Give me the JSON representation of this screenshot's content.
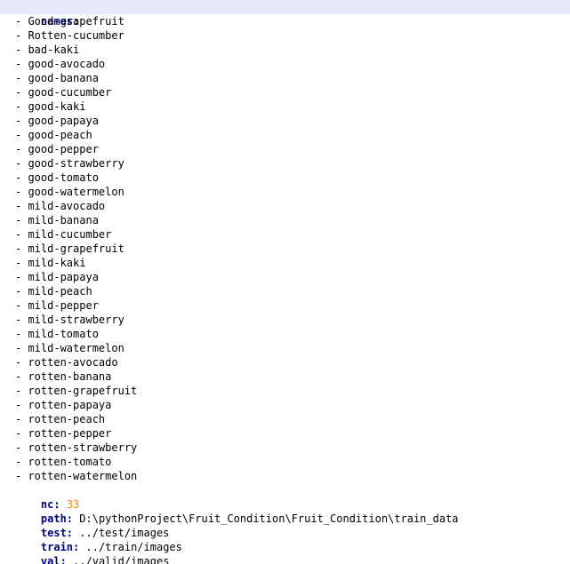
{
  "editor": {
    "names_key": "names:",
    "items": [
      "Good-grapefruit",
      "Rotten-cucumber",
      "bad-kaki",
      "good-avocado",
      "good-banana",
      "good-cucumber",
      "good-kaki",
      "good-papaya",
      "good-peach",
      "good-pepper",
      "good-strawberry",
      "good-tomato",
      "good-watermelon",
      "mild-avocado",
      "mild-banana",
      "mild-cucumber",
      "mild-grapefruit",
      "mild-kaki",
      "mild-papaya",
      "mild-peach",
      "mild-pepper",
      "mild-strawberry",
      "mild-tomato",
      "mild-watermelon",
      "rotten-avocado",
      "rotten-banana",
      "rotten-grapefruit",
      "rotten-papaya",
      "rotten-peach",
      "rotten-pepper",
      "rotten-strawberry",
      "rotten-tomato",
      "rotten-watermelon"
    ],
    "nc_key": "nc:",
    "nc_value": "33",
    "path_key": "path:",
    "path_value": "D:\\pythonProject\\Fruit_Condition\\Fruit_Condition\\train_data",
    "test_key": "test:",
    "test_value": "../test/images",
    "train_key": "train:",
    "train_value": "../train/images",
    "val_key": "val:",
    "val_value": "../valid/images"
  },
  "colors": {
    "key": "#000080",
    "number": "#ff8000",
    "current_line": "#e8e8ff"
  }
}
